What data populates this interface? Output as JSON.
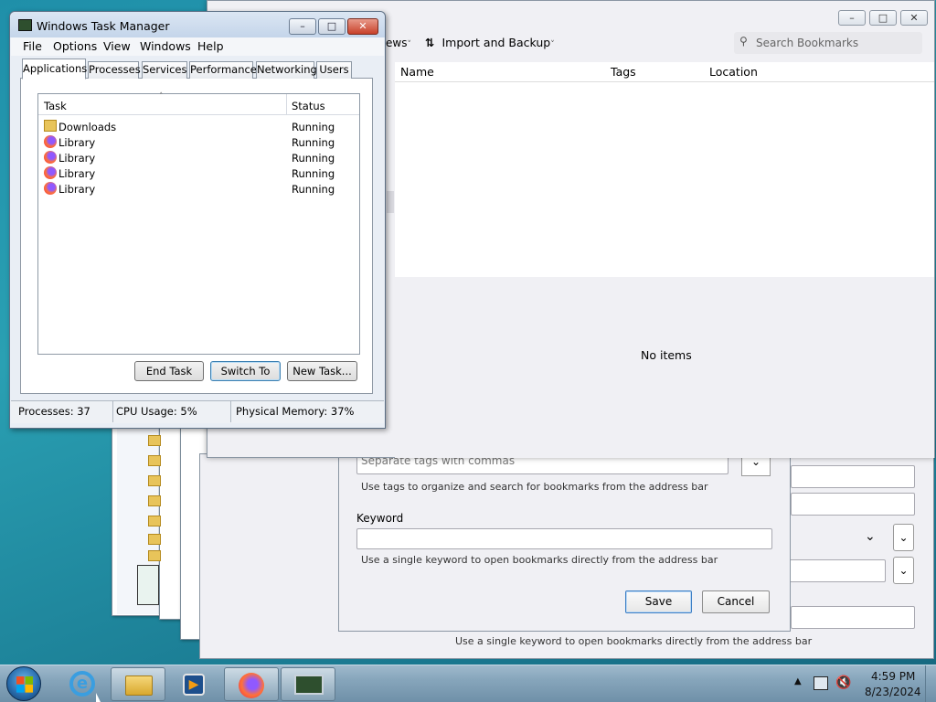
{
  "task_manager": {
    "title": "Windows Task Manager",
    "menu": [
      "File",
      "Options",
      "View",
      "Windows",
      "Help"
    ],
    "tabs": [
      "Applications",
      "Processes",
      "Services",
      "Performance",
      "Networking",
      "Users"
    ],
    "columns": {
      "task": "Task",
      "status": "Status"
    },
    "tasks": [
      {
        "name": "Downloads",
        "status": "Running",
        "icon": "folder-icon"
      },
      {
        "name": "Library",
        "status": "Running",
        "icon": "firefox-icon"
      },
      {
        "name": "Library",
        "status": "Running",
        "icon": "firefox-icon"
      },
      {
        "name": "Library",
        "status": "Running",
        "icon": "firefox-icon"
      },
      {
        "name": "Library",
        "status": "Running",
        "icon": "firefox-icon"
      }
    ],
    "buttons": {
      "end_task": "End Task",
      "switch_to": "Switch To",
      "new_task": "New Task..."
    },
    "status": {
      "processes": "Processes: 37",
      "cpu": "CPU Usage: 5%",
      "memory": "Physical Memory: 37%"
    }
  },
  "library": {
    "toolbar": {
      "views_fragment": "ews",
      "import_backup": "Import and Backup",
      "search_placeholder": "Search Bookmarks"
    },
    "columns": {
      "name": "Name",
      "tags": "Tags",
      "location": "Location"
    },
    "empty_text": "No items"
  },
  "bookmark_dialog": {
    "tags_placeholder": "Separate tags with commas",
    "tags_hint": "Use tags to organize and search for bookmarks from the address bar",
    "keyword_label": "Keyword",
    "keyword_value": "",
    "keyword_hint": "Use a single keyword to open bookmarks directly from the address bar",
    "save": "Save",
    "cancel": "Cancel"
  },
  "back_dialog": {
    "keyword_hint": "Use a single keyword to open bookmarks directly from the address bar"
  },
  "taskbar": {
    "time": "4:59 PM",
    "date": "8/23/2024"
  }
}
